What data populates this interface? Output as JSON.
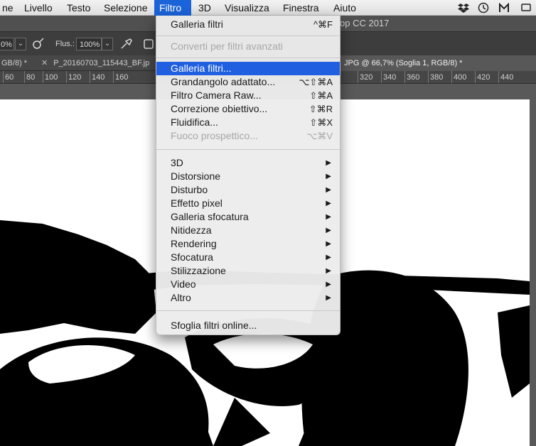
{
  "menubar": {
    "items": [
      {
        "label": "ne",
        "active": false
      },
      {
        "label": "Livello",
        "active": false
      },
      {
        "label": "Testo",
        "active": false
      },
      {
        "label": "Selezione",
        "active": false
      },
      {
        "label": "Filtro",
        "active": true
      },
      {
        "label": "3D",
        "active": false
      },
      {
        "label": "Visualizza",
        "active": false
      },
      {
        "label": "Finestra",
        "active": false
      },
      {
        "label": "Aiuto",
        "active": false
      }
    ],
    "tray_icons": [
      "dropbox-icon",
      "time-machine-icon",
      "malwarebytes-icon",
      "system-icon"
    ]
  },
  "app": {
    "title_fragment": "op CC 2017"
  },
  "options": {
    "opacity_value": "0%",
    "flow_label": "Flus.:",
    "flow_value": "100%"
  },
  "tabs": [
    {
      "label": "GB/8) *",
      "active": false,
      "closable": false
    },
    {
      "label": "P_20160703_115443_BF.jp",
      "active": false,
      "closable": true
    },
    {
      "label": "JPG @ 66,7% (Soglia 1, RGB/8) *",
      "active": true,
      "closable": false
    }
  ],
  "ruler": {
    "ticks": [
      "60",
      "80",
      "100",
      "120",
      "140",
      "160",
      "",
      "",
      "",
      "",
      "",
      "",
      "",
      "",
      "",
      "",
      "",
      "320",
      "340",
      "360",
      "380",
      "400",
      "420",
      "440"
    ]
  },
  "filter_menu": {
    "top": [
      {
        "label": "Galleria filtri",
        "shortcut": "^⌘F",
        "disabled": false
      }
    ],
    "group1": [
      {
        "label": "Converti per filtri avanzati",
        "disabled": true
      }
    ],
    "group2": [
      {
        "label": "Galleria filtri...",
        "shortcut": "",
        "disabled": false,
        "highlight": true
      },
      {
        "label": "Grandangolo adattato...",
        "shortcut": "⌥⇧⌘A",
        "disabled": false
      },
      {
        "label": "Filtro Camera Raw...",
        "shortcut": "⇧⌘A",
        "disabled": false
      },
      {
        "label": "Correzione obiettivo...",
        "shortcut": "⇧⌘R",
        "disabled": false
      },
      {
        "label": "Fluidifica...",
        "shortcut": "⇧⌘X",
        "disabled": false
      },
      {
        "label": "Fuoco prospettico...",
        "shortcut": "⌥⌘V",
        "disabled": true
      }
    ],
    "submenus": [
      {
        "label": "3D"
      },
      {
        "label": "Distorsione"
      },
      {
        "label": "Disturbo"
      },
      {
        "label": "Effetto pixel"
      },
      {
        "label": "Galleria sfocatura"
      },
      {
        "label": "Nitidezza"
      },
      {
        "label": "Rendering"
      },
      {
        "label": "Sfocatura"
      },
      {
        "label": "Stilizzazione"
      },
      {
        "label": "Video"
      },
      {
        "label": "Altro"
      }
    ],
    "footer": [
      {
        "label": "Sfoglia filtri online..."
      }
    ]
  }
}
